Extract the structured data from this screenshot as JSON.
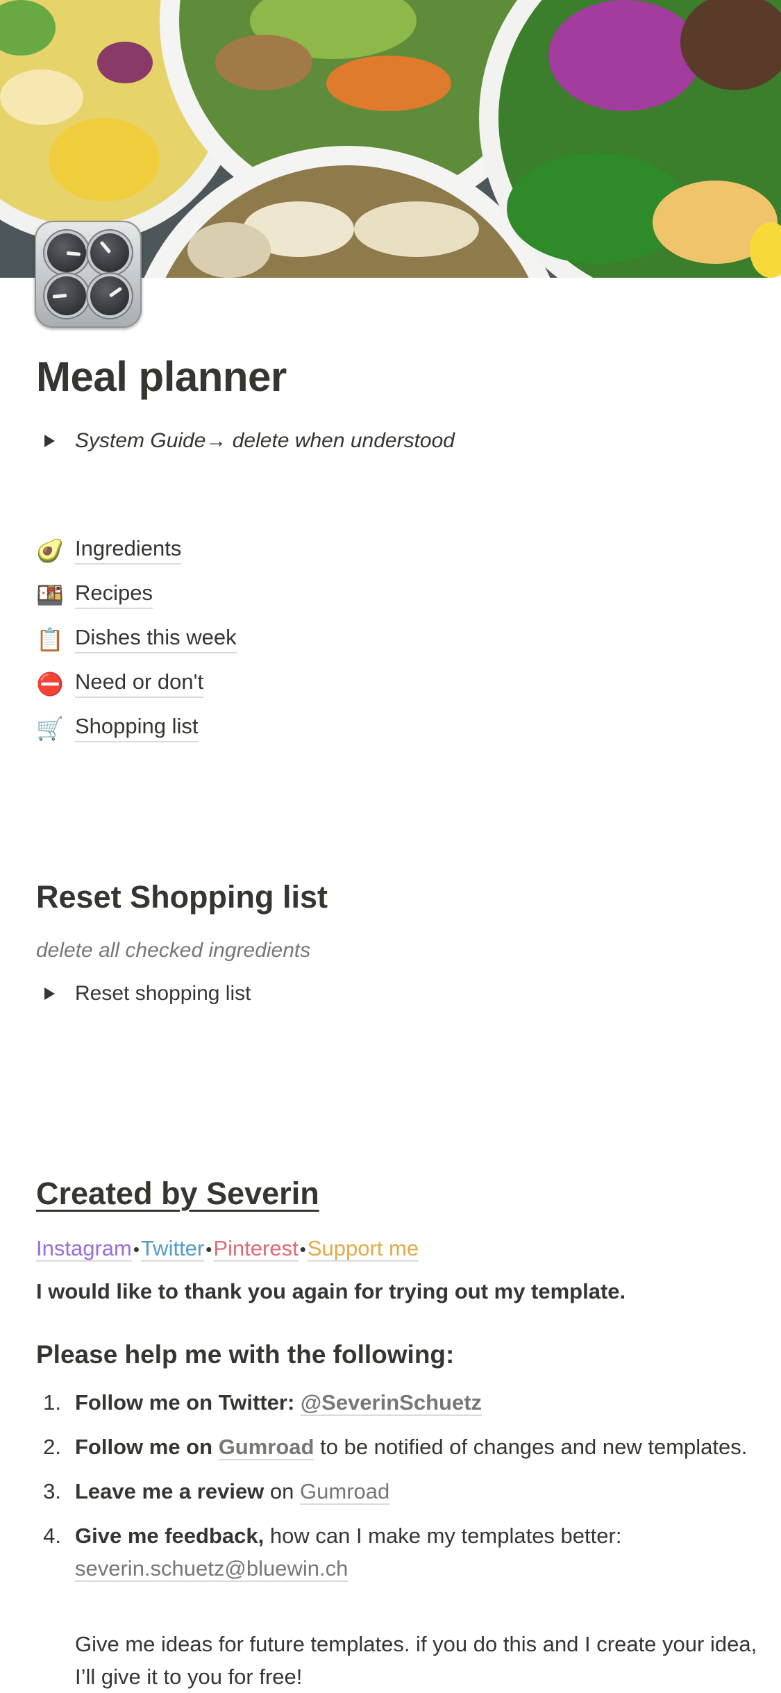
{
  "cover": {
    "alt_colors": {
      "salad_green": "#3f8a2e",
      "cabbage": "#8a2f8e",
      "bowl": "#f4f4f2",
      "table": "#4a5458"
    }
  },
  "page": {
    "title": "Meal planner",
    "icon": "control-knobs-icon"
  },
  "guide_toggle": {
    "label": "System Guide→ delete when understood"
  },
  "links": [
    {
      "emoji": "🥑",
      "icon": "avocado-icon",
      "label": "Ingredients"
    },
    {
      "emoji": "🍱",
      "icon": "bento-box-icon",
      "label": "Recipes"
    },
    {
      "emoji": "📋",
      "icon": "clipboard-icon",
      "label": "Dishes this week"
    },
    {
      "emoji": "⛔",
      "icon": "no-entry-icon",
      "label": "Need or don't"
    },
    {
      "emoji": "🛒",
      "icon": "shopping-cart-icon",
      "label": "Shopping list"
    }
  ],
  "reset_section": {
    "heading": "Reset Shopping list",
    "description": "delete all checked ingredients",
    "toggle_label": "Reset shopping list"
  },
  "creator_section": {
    "heading": "Created by Severin",
    "social": [
      {
        "label": "Instagram",
        "color": "#9a6dd7"
      },
      {
        "label": "Twitter",
        "color": "#529cca"
      },
      {
        "label": "Pinterest",
        "color": "#e16b75"
      },
      {
        "label": "Support me",
        "color": "#dfab46"
      }
    ],
    "separator": "•",
    "thanks": "I would like to thank you again for trying out my template.",
    "help_heading": "Please help me with the following:",
    "items": [
      {
        "num": "1.",
        "bold": "Follow me on Twitter:",
        "link": "@SeverinSchuetz"
      },
      {
        "num": "2.",
        "bold": "Follow me on",
        "link": "Gumroad",
        "rest": "to be notified of changes and new templates."
      },
      {
        "num": "3.",
        "bold": "Leave me a review",
        "mid": "on",
        "link": "Gumroad"
      },
      {
        "num": "4.",
        "bold": "Give me feedback,",
        "rest": "how can I make my templates better:",
        "link": "severin.schuetz@bluewin.ch"
      }
    ],
    "extra": "Give me ideas for future templates. if you do this and I create your idea, I’ll give it to you for free!"
  }
}
